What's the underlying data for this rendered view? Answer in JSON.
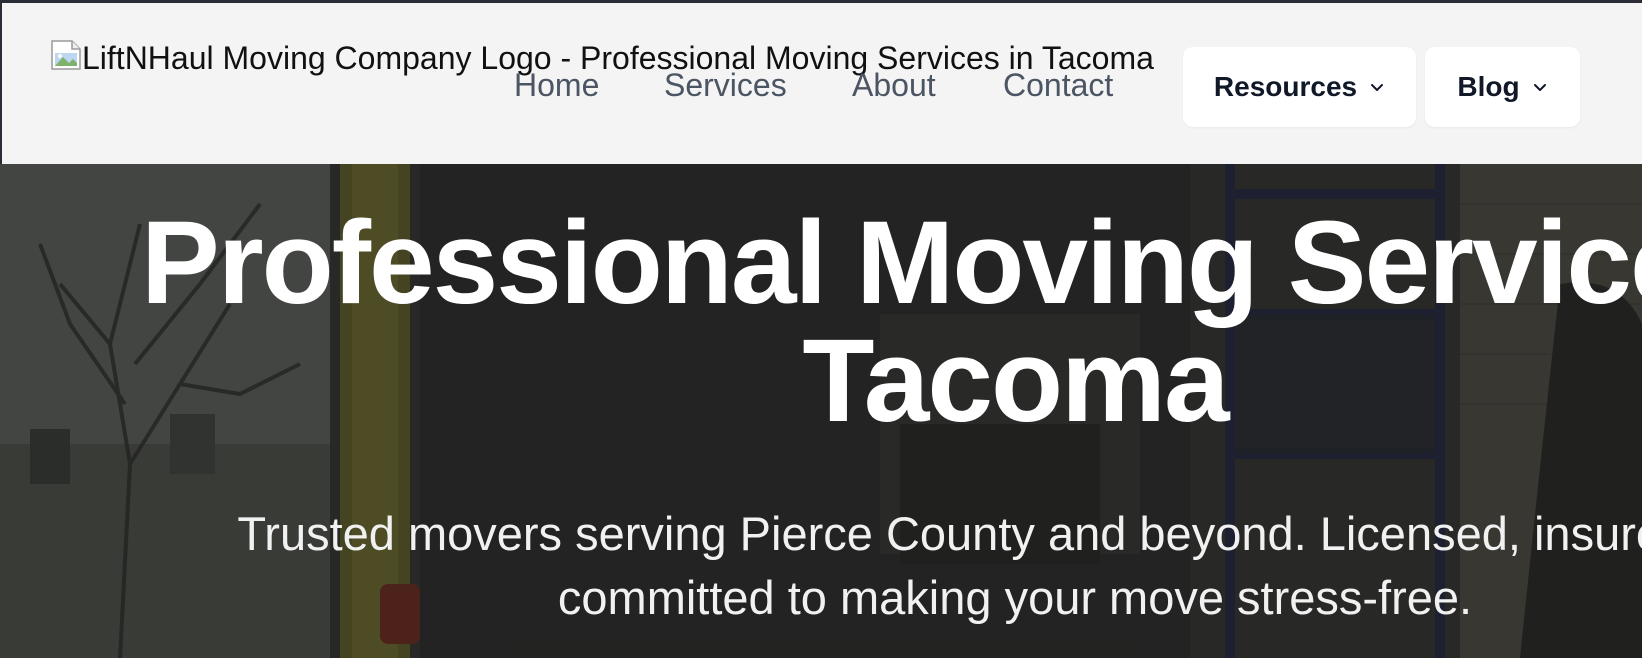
{
  "header": {
    "logo_alt": "LiftNHaul Moving Company Logo - Professional Moving Services in Tacoma",
    "nav": {
      "home": "Home",
      "services": "Services",
      "about": "About",
      "contact": "Contact"
    },
    "dropdowns": {
      "resources": "Resources",
      "blog": "Blog"
    }
  },
  "hero": {
    "title_line1": "Professional Moving Services in",
    "title_line2": "Tacoma",
    "subtitle_line1": "Trusted movers serving Pierce County and beyond. Licensed, insured, and",
    "subtitle_line2": "committed to making your move stress-free."
  },
  "colors": {
    "header_bg": "#f4f4f4",
    "nav_text": "#4b5563",
    "button_bg": "#ffffff",
    "hero_text": "#ffffff"
  },
  "icons": {
    "logo": "broken-image-icon",
    "dropdown": "chevron-down-icon"
  }
}
